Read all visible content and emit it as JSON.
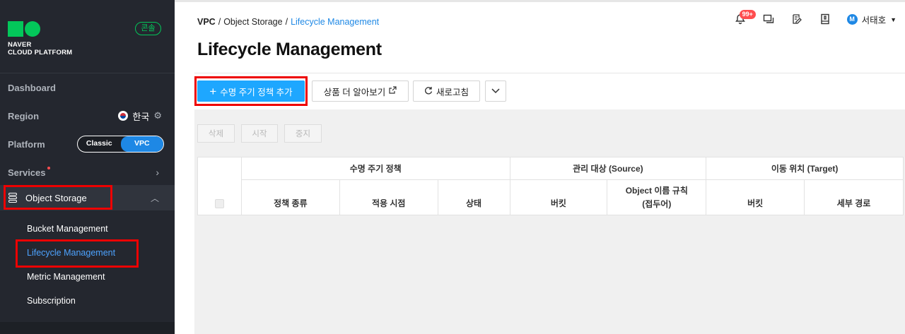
{
  "sidebar": {
    "brand_line1": "NAVER",
    "brand_line2": "CLOUD PLATFORM",
    "console_label": "콘솔",
    "dashboard": "Dashboard",
    "region_label": "Region",
    "region_value": "한국",
    "platform_label": "Platform",
    "platform_options": [
      "Classic",
      "VPC"
    ],
    "platform_selected": "VPC",
    "services_label": "Services",
    "object_storage": "Object Storage",
    "sub_items": [
      "Bucket Management",
      "Lifecycle Management",
      "Metric Management",
      "Subscription"
    ],
    "active_sub_item": "Lifecycle Management"
  },
  "header": {
    "breadcrumb": [
      "VPC",
      "Object Storage",
      "Lifecycle Management"
    ],
    "title": "Lifecycle Management",
    "notification_count": "99+",
    "user_initial": "M",
    "user_name": "서태호"
  },
  "toolbar": {
    "add_policy": "수명 주기 정책 추가",
    "learn_more": "상품 더 알아보기",
    "refresh": "새로고침"
  },
  "actions": {
    "delete": "삭제",
    "start": "시작",
    "stop": "중지"
  },
  "table": {
    "group_headers": [
      "수명 주기 정책",
      "관리 대상 (Source)",
      "이동 위치 (Target)"
    ],
    "columns": [
      "정책 종류",
      "적용 시점",
      "상태",
      "버킷",
      "Object 이름 규칙",
      "(접두어)",
      "버킷",
      "세부 경로"
    ]
  },
  "colors": {
    "sidebar_bg": "#24272f",
    "brand_green": "#03c75a",
    "primary_blue": "#1ea7ff",
    "link_blue": "#1e88e5",
    "highlight_red": "#ee0000"
  }
}
